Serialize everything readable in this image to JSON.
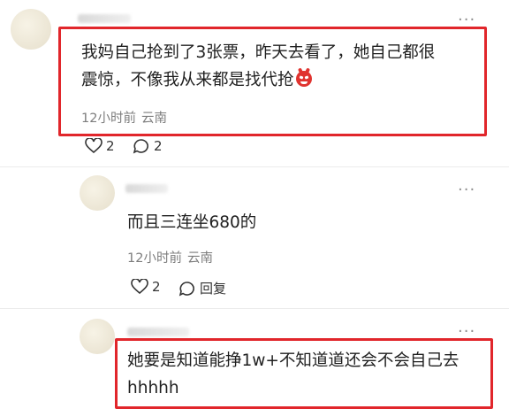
{
  "comment1": {
    "text_line1": "我妈自己抢到了3张票，昨天去看了，她自己都很",
    "text_line2": "震惊，不像我从来都是找代抢",
    "emoji": "angry-face",
    "time": "12小时前",
    "location": "云南",
    "like_count": "2",
    "reply_count": "2"
  },
  "reply1": {
    "text": "而且三连坐680的",
    "time": "12小时前",
    "location": "云南",
    "like_count": "2",
    "reply_label": "回复"
  },
  "comment2": {
    "text_line1": "她要是知道能挣1w+不知道道还会不会自己去",
    "text_line2": "hhhhh"
  },
  "colors": {
    "highlight": "#e1262b",
    "meta": "#7d7d7d"
  }
}
